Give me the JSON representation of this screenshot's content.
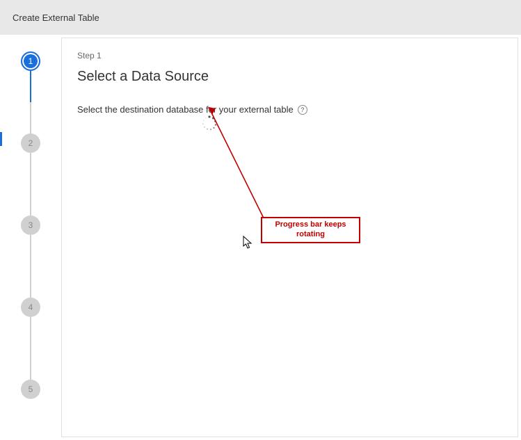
{
  "header": {
    "title": "Create External Table"
  },
  "stepper": {
    "active_index": 0,
    "steps": [
      {
        "num": "1"
      },
      {
        "num": "2"
      },
      {
        "num": "3"
      },
      {
        "num": "4"
      },
      {
        "num": "5"
      }
    ]
  },
  "content": {
    "step_label": "Step 1",
    "step_title": "Select a Data Source",
    "instruction": "Select the destination database for your external table",
    "help_glyph": "?"
  },
  "annotation": {
    "text": "Progress bar keeps rotating"
  },
  "colors": {
    "accent": "#1a6fdb",
    "annotation": "#c00000"
  }
}
